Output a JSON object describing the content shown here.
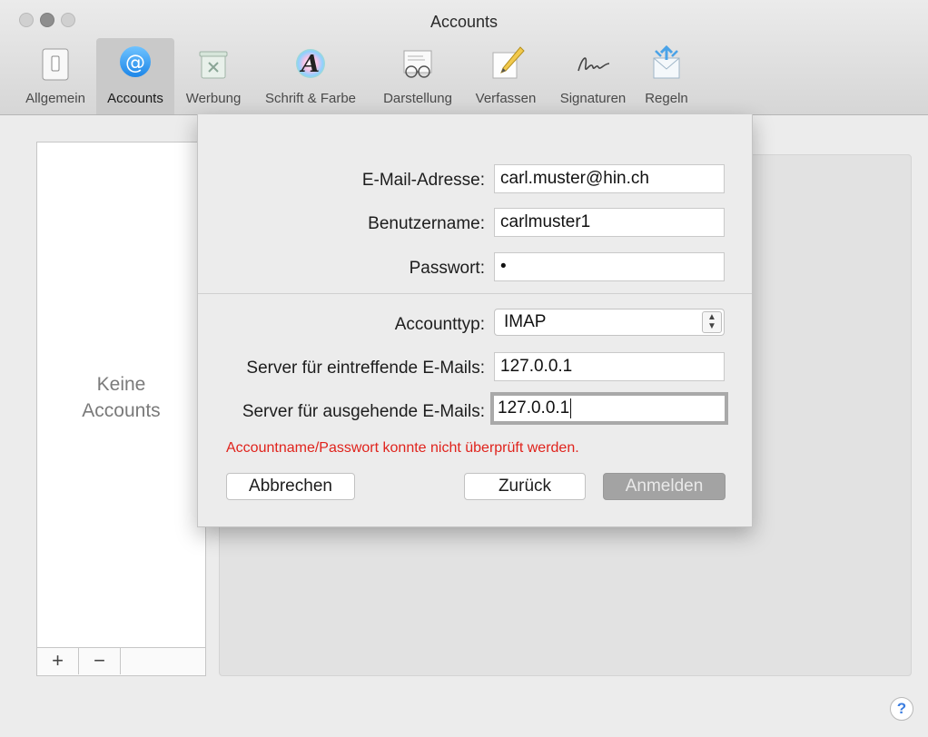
{
  "window": {
    "title": "Accounts"
  },
  "toolbar": {
    "tabs": [
      {
        "label": "Allgemein",
        "icon": "switch-icon"
      },
      {
        "label": "Accounts",
        "icon": "at-sign-icon",
        "active": true
      },
      {
        "label": "Werbung",
        "icon": "junk-trash-icon"
      },
      {
        "label": "Schrift & Farbe",
        "icon": "fonts-colors-icon"
      },
      {
        "label": "Darstellung",
        "icon": "glasses-letter-icon"
      },
      {
        "label": "Verfassen",
        "icon": "pencil-note-icon"
      },
      {
        "label": "Signaturen",
        "icon": "signature-icon"
      },
      {
        "label": "Regeln",
        "icon": "envelope-arrows-icon"
      }
    ]
  },
  "accounts_list": {
    "empty_line1": "Keine",
    "empty_line2": "Accounts",
    "add_label": "+",
    "remove_label": "−"
  },
  "sheet": {
    "email": {
      "label": "E-Mail-Adresse:",
      "value": "carl.muster@hin.ch"
    },
    "username": {
      "label": "Benutzername:",
      "value": "carlmuster1"
    },
    "password": {
      "label": "Passwort:",
      "value": "•"
    },
    "account_type": {
      "label": "Accounttyp:",
      "value": "IMAP"
    },
    "incoming": {
      "label": "Server für eintreffende E-Mails:",
      "value": "127.0.0.1"
    },
    "outgoing": {
      "label": "Server für ausgehende E-Mails:",
      "value": "127.0.0.1"
    },
    "error": "Accountname/Passwort konnte nicht überprüft werden.",
    "cancel_label": "Abbrechen",
    "back_label": "Zurück",
    "signin_label": "Anmelden"
  },
  "help": {
    "label": "?"
  },
  "colors": {
    "error": "#e0231c",
    "accent": "#3b7de0",
    "disabled_button": "#a3a3a3"
  }
}
